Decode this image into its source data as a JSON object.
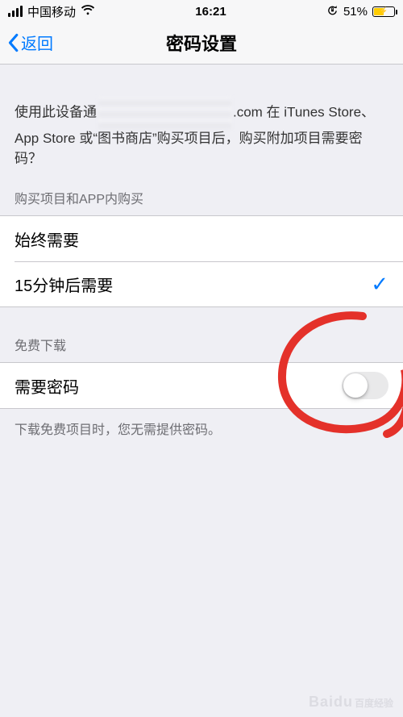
{
  "status": {
    "carrier": "中国移动",
    "time": "16:21",
    "battery_percent": "51%"
  },
  "nav": {
    "back_label": "返回",
    "title": "密码设置"
  },
  "intro": {
    "prefix": "使用此设备通",
    "suffix": ".com 在 iTunes Store、App Store 或“图书商店”购买项目后，购买附加项目需要密码？"
  },
  "purchase": {
    "header": "购买项目和APP内购买",
    "options": [
      {
        "label": "始终需要",
        "selected": false
      },
      {
        "label": "15分钟后需要",
        "selected": true
      }
    ]
  },
  "free": {
    "header": "免费下载",
    "row_label": "需要密码",
    "toggle_on": false,
    "footer": "下载免费项目时，您无需提供密码。"
  },
  "watermark": {
    "brand": "Baidu",
    "sub": "百度经验"
  }
}
